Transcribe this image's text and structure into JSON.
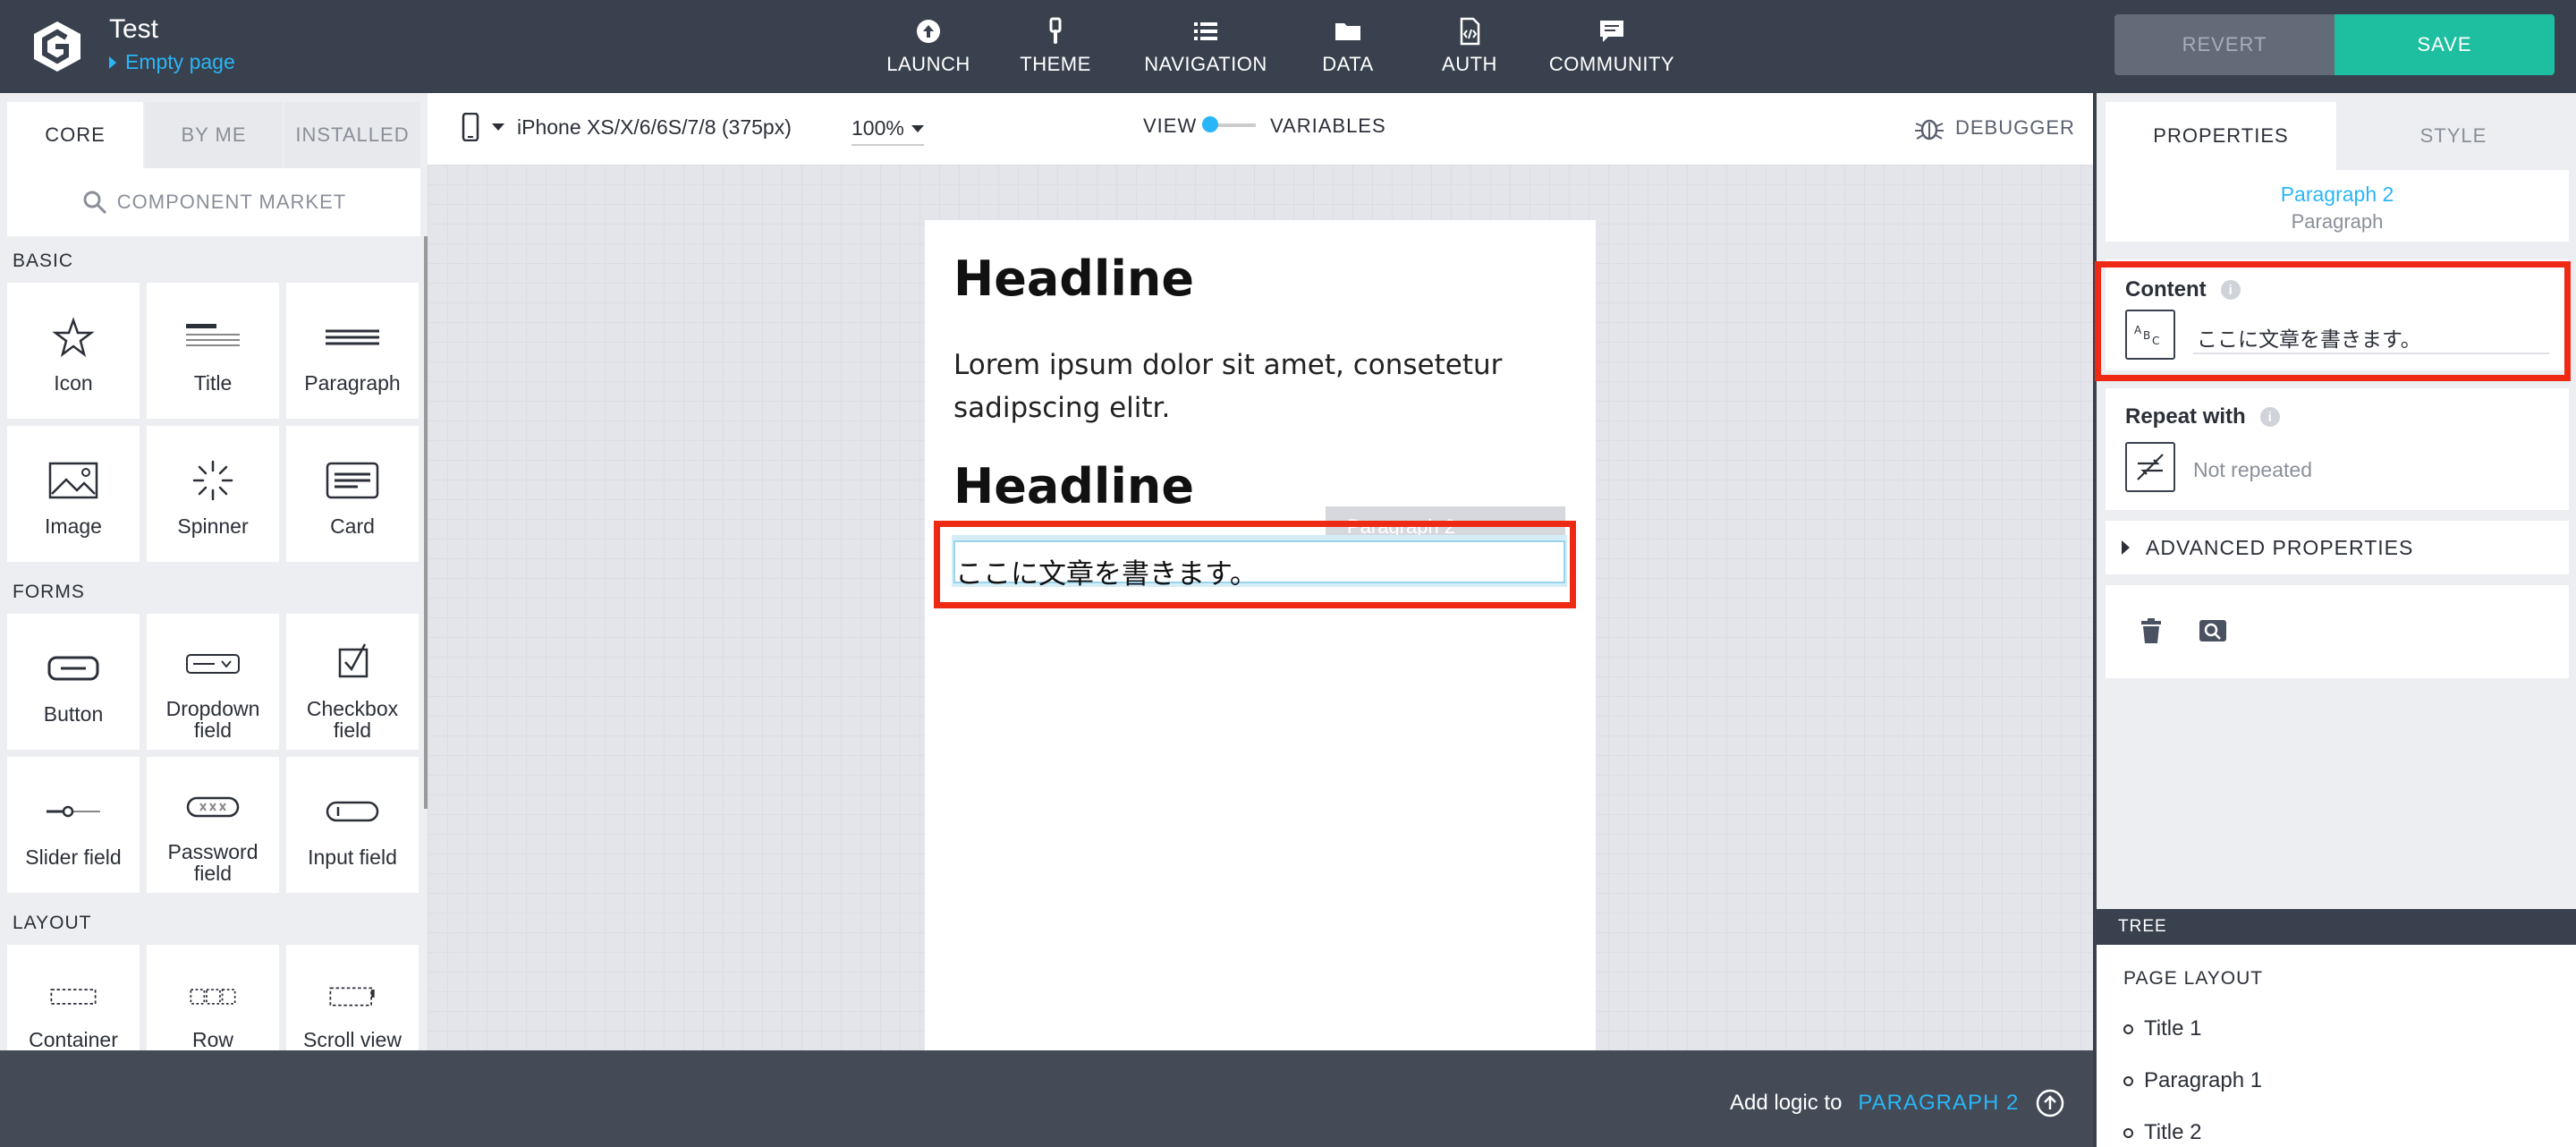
{
  "app": {
    "title": "Test",
    "page": "Empty page"
  },
  "nav": [
    {
      "label": "LAUNCH",
      "icon": "launch-icon"
    },
    {
      "label": "THEME",
      "icon": "brush-icon"
    },
    {
      "label": "NAVIGATION",
      "icon": "list-icon"
    },
    {
      "label": "DATA",
      "icon": "folder-icon"
    },
    {
      "label": "AUTH",
      "icon": "code-file-icon"
    },
    {
      "label": "COMMUNITY",
      "icon": "chat-icon"
    }
  ],
  "actions": {
    "revert": "REVERT",
    "save": "SAVE"
  },
  "left": {
    "tabs": [
      "CORE",
      "BY ME",
      "INSTALLED"
    ],
    "market": "COMPONENT MARKET",
    "sections": {
      "basic": {
        "title": "BASIC",
        "items": [
          "Icon",
          "Title",
          "Paragraph",
          "Image",
          "Spinner",
          "Card"
        ]
      },
      "forms": {
        "title": "FORMS",
        "items": [
          "Button",
          "Dropdown field",
          "Checkbox field",
          "Slider field",
          "Password field",
          "Input field"
        ]
      },
      "layout": {
        "title": "LAYOUT",
        "items": [
          "Container",
          "Row",
          "Scroll view"
        ]
      }
    }
  },
  "toolbar": {
    "device": "iPhone XS/X/6/6S/7/8 (375px)",
    "zoom": "100%",
    "view": "VIEW",
    "variables": "VARIABLES",
    "debugger": "DEBUGGER"
  },
  "canvas": {
    "headline1": "Headline",
    "para1": "Lorem ipsum dolor sit amet, consetetur sadipscing elitr.",
    "headline2": "Headline",
    "selected_tag": "Paragraph 2",
    "para2": "ここに文章を書きます。"
  },
  "bottom": {
    "add_logic": "Add logic to",
    "target": "PARAGRAPH 2"
  },
  "right": {
    "tabs": [
      "PROPERTIES",
      "STYLE"
    ],
    "selected_name": "Paragraph 2",
    "selected_type": "Paragraph",
    "content_label": "Content",
    "content_value": "ここに文章を書きます。",
    "repeat_label": "Repeat with",
    "repeat_value": "Not repeated",
    "advanced": "ADVANCED PROPERTIES",
    "tree_header": "TREE",
    "tree_title": "PAGE LAYOUT",
    "tree_items": [
      "Title 1",
      "Paragraph 1",
      "Title 2"
    ]
  },
  "colors": {
    "accent": "#29b6f6",
    "save": "#1dbfa0",
    "highlight": "#ee2a14",
    "topbar": "#3a414e"
  }
}
